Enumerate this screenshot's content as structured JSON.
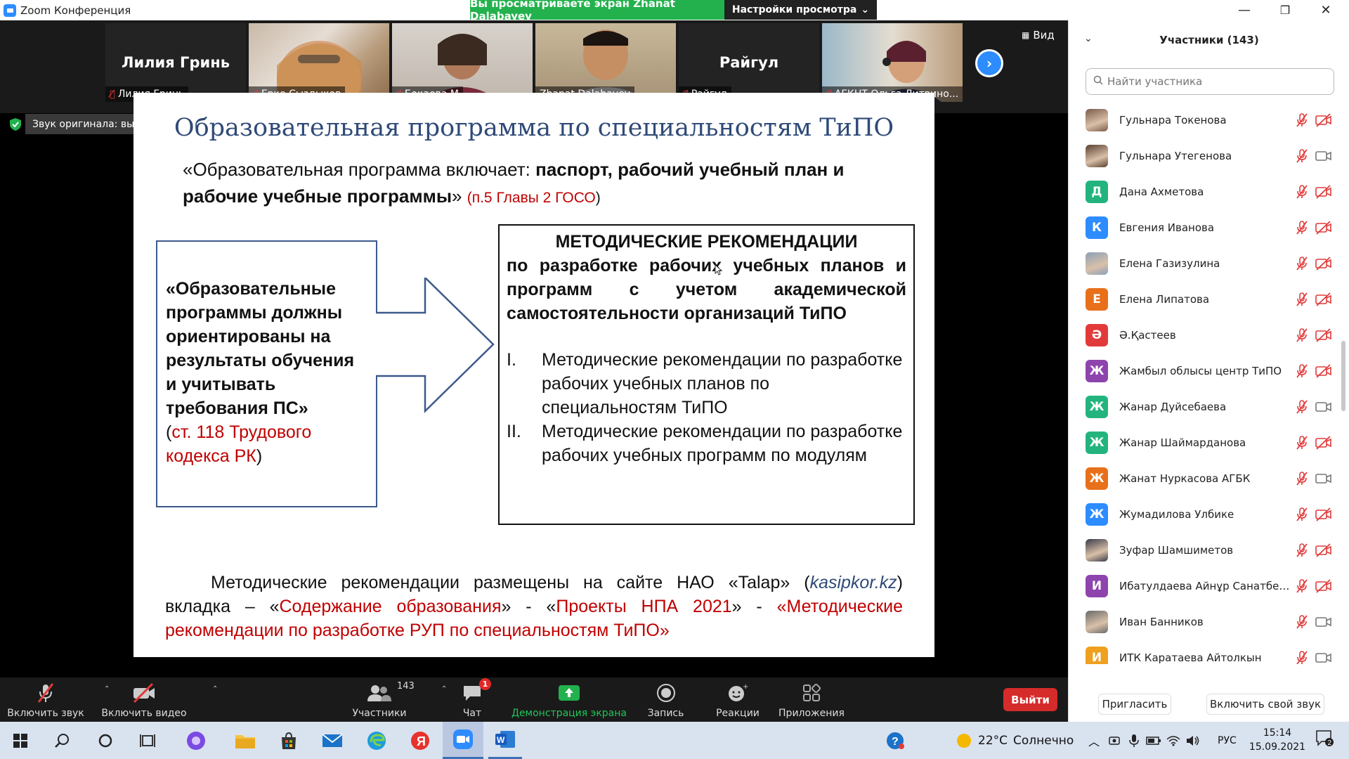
{
  "window": {
    "title": "Zoom Конференция",
    "share_banner": "Вы просматриваете экран Zhanat Dalabayev",
    "view_options": "Настройки просмотра"
  },
  "video_strip": {
    "tiles": [
      {
        "big_name": "Лилия Гринь",
        "name": "Лилия Гринь",
        "photo": false
      },
      {
        "big_name": "",
        "name": "Ерке Сыздыков",
        "photo": true
      },
      {
        "big_name": "",
        "name": "Бокаева М",
        "photo": true
      },
      {
        "big_name": "",
        "name": "Zhanat Dalabayev",
        "photo": true
      },
      {
        "big_name": "Райгул",
        "name": "Райгул",
        "photo": false
      },
      {
        "big_name": "",
        "name": "АГКНТ Ольга Литвино...",
        "photo": true
      }
    ],
    "view_label": "Вид"
  },
  "audio_badge": {
    "label": "Звук оригинала: выкл."
  },
  "slide": {
    "title": "Образовательная программа  по специальностям ТиПО",
    "quote_open": "«Образовательная программа включает: ",
    "quote_bold": "паспорт, рабочий учебный план и рабочие учебные программы",
    "quote_close": "» ",
    "quote_ref": "п.5 Главы 2 ГОСО",
    "left_box_bold": "«Образовательные программы должны ориентированы на результаты обучения и учитывать требования ПС»",
    "left_box_ref_open": "(",
    "left_box_ref": "ст. 118 Трудового кодекса РК",
    "left_box_ref_close": ")",
    "right_box_heading": "МЕТОДИЧЕСКИЕ РЕКОМЕНДАЦИИ",
    "right_box_sub": "по разработке рабочих учебных планов и программ с учетом академической самостоятельности организаций ТиПО",
    "right_box_items": [
      {
        "num": "I.",
        "text": "Методические рекомендации по разработке рабочих учебных планов по специальностям ТиПО"
      },
      {
        "num": "II.",
        "text": "Методические рекомендации по разработке рабочих учебных программ по модулям"
      }
    ],
    "bottom_1": "Методические рекомендации размещены на сайте НАО «Talap» (",
    "bottom_site": "kasipkor.kz",
    "bottom_2": ") вкладка – «",
    "bottom_r1": "Содержание образования",
    "bottom_3": "» - «",
    "bottom_r2": "Проекты НПА 2021",
    "bottom_4": "» - ",
    "bottom_r3": "«Методические рекомендации по разработке РУП по специальностям ТиПО»"
  },
  "toolbar": {
    "unmute": "Включить звук",
    "start_video": "Включить видео",
    "participants": "Участники",
    "participants_count": "143",
    "chat": "Чат",
    "chat_badge": "1",
    "share": "Демонстрация экрана",
    "record": "Запись",
    "reactions": "Реакции",
    "apps": "Приложения",
    "leave": "Выйти"
  },
  "participants_panel": {
    "title": "Участники (143)",
    "search_placeholder": "Найти участника",
    "list": [
      {
        "name": "Гульнара Токенова",
        "initial": "",
        "color": "#7a5a4a",
        "photo": true,
        "cam_off": true
      },
      {
        "name": "Гульнара Утегенова",
        "initial": "",
        "color": "#5a4030",
        "photo": true,
        "cam_off": false
      },
      {
        "name": "Дана Ахметова",
        "initial": "Д",
        "color": "#23b47e",
        "photo": false,
        "cam_off": true
      },
      {
        "name": "Евгения Иванова",
        "initial": "К",
        "color": "#2d8cff",
        "photo": false,
        "cam_off": true
      },
      {
        "name": "Елена Газизулина",
        "initial": "",
        "color": "#8aa0b8",
        "photo": true,
        "cam_off": true
      },
      {
        "name": "Елена Липатова",
        "initial": "Е",
        "color": "#e8701a",
        "photo": false,
        "cam_off": true
      },
      {
        "name": "Ә.Қастеев",
        "initial": "Ә",
        "color": "#e23a3a",
        "photo": false,
        "cam_off": true
      },
      {
        "name": "Жамбыл  облысы центр ТиПО",
        "initial": "Ж",
        "color": "#8e44ad",
        "photo": false,
        "cam_off": true
      },
      {
        "name": "Жанар Дуйсебаева",
        "initial": "Ж",
        "color": "#23b47e",
        "photo": false,
        "cam_off": false
      },
      {
        "name": "Жанар Шаймарданова",
        "initial": "Ж",
        "color": "#23b47e",
        "photo": false,
        "cam_off": true
      },
      {
        "name": "Жанат Нуркасова АГБК",
        "initial": "Ж",
        "color": "#e8701a",
        "photo": false,
        "cam_off": false
      },
      {
        "name": "Жумадилова Улбике",
        "initial": "Ж",
        "color": "#2d8cff",
        "photo": false,
        "cam_off": true
      },
      {
        "name": "Зуфар Шамшиметов",
        "initial": "",
        "color": "#3a3a4a",
        "photo": true,
        "cam_off": true
      },
      {
        "name": "Ибатулдаева Айнұр Санатбекқы...",
        "initial": "И",
        "color": "#8e44ad",
        "photo": false,
        "cam_off": true
      },
      {
        "name": "Иван Банников",
        "initial": "",
        "color": "#6a6a6a",
        "photo": true,
        "cam_off": false
      },
      {
        "name": "ИТК Каратаева Айтолкын",
        "initial": "И",
        "color": "#f0a020",
        "photo": false,
        "cam_off": false
      }
    ],
    "invite": "Пригласить",
    "unmute_me": "Включить свой звук"
  },
  "taskbar": {
    "weather_temp": "22°C",
    "weather_text": "Солнечно",
    "lang": "РУС",
    "time": "15:14",
    "date": "15.09.2021"
  }
}
